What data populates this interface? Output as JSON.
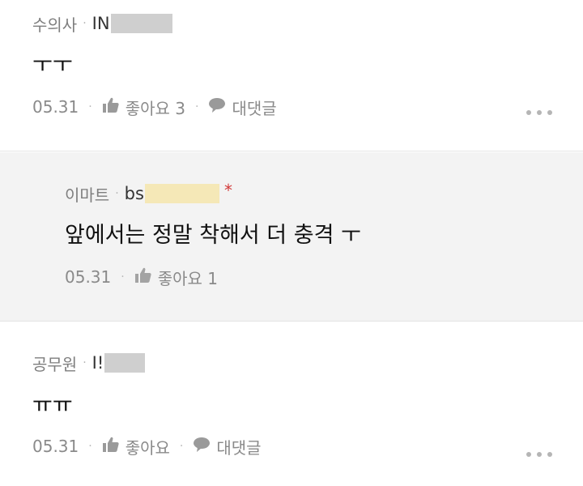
{
  "comments": [
    {
      "category": "수의사",
      "user_prefix": "IN",
      "text": "ㅜㅜ",
      "date": "05.31",
      "like_label": "좋아요 3",
      "reply_label": "대댓글"
    },
    {
      "category": "이마트",
      "user_prefix": "bs",
      "star": "*",
      "text": "앞에서는 정말 착해서 더 충격 ㅜ",
      "date": "05.31",
      "like_label": "좋아요 1"
    },
    {
      "category": "공무원",
      "user_prefix": "I!",
      "text": "ㅠㅠ",
      "date": "05.31",
      "like_label": "좋아요",
      "reply_label": "대댓글"
    }
  ],
  "separator_dot": "·",
  "icons": {
    "like": "thumbs-up-icon",
    "reply": "speech-bubble-icon",
    "more": "more-options-icon"
  },
  "colors": {
    "reply_background": "#f3f3f3",
    "star": "#d23a3a",
    "mask_gray": "#cfcfcf",
    "mask_yellow": "#f5e8b7"
  }
}
